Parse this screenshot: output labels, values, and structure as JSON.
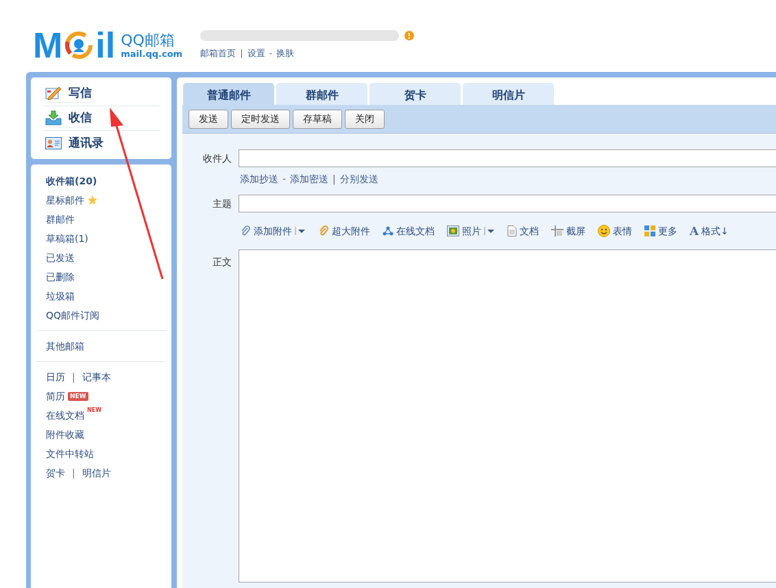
{
  "logo": {
    "left": "M",
    "right": "il",
    "name": "QQ邮箱",
    "domain": "mail.qq.com"
  },
  "top_links": [
    {
      "kind": "link",
      "text": "邮箱首页"
    },
    {
      "kind": "sep",
      "text": "|"
    },
    {
      "kind": "link",
      "text": "设置"
    },
    {
      "kind": "sep",
      "text": "-"
    },
    {
      "kind": "link",
      "text": "换肤"
    }
  ],
  "quick_actions": [
    {
      "kind": "compose",
      "label": "写信"
    },
    {
      "kind": "inbox",
      "label": "收信"
    },
    {
      "kind": "contacts",
      "label": "通讯录"
    }
  ],
  "folders": [
    {
      "kind": "item",
      "label": "收件箱(20)",
      "bold": true
    },
    {
      "kind": "item",
      "label": "星标邮件",
      "star": true
    },
    {
      "kind": "item",
      "label": "群邮件"
    },
    {
      "kind": "item",
      "label": "草稿箱(1)"
    },
    {
      "kind": "item",
      "label": "已发送"
    },
    {
      "kind": "item",
      "label": "已删除"
    },
    {
      "kind": "item",
      "label": "垃圾箱"
    },
    {
      "kind": "item",
      "label": "QQ邮件订阅"
    },
    {
      "kind": "divider"
    },
    {
      "kind": "item",
      "label": "其他邮箱"
    },
    {
      "kind": "divider"
    },
    {
      "kind": "pair",
      "label": "日历",
      "sep": "|",
      "label2": "记事本"
    },
    {
      "kind": "item",
      "label": "简历",
      "badge": {
        "text": "NEW",
        "kind": "box"
      }
    },
    {
      "kind": "item",
      "label": "在线文档",
      "badge": {
        "text": "NEW",
        "kind": "raised"
      }
    },
    {
      "kind": "item",
      "label": "附件收藏"
    },
    {
      "kind": "item",
      "label": "文件中转站"
    },
    {
      "kind": "pair",
      "label": "贺卡",
      "sep": "|",
      "label2": "明信片"
    }
  ],
  "tabs": [
    {
      "label": "普通邮件",
      "selected": true
    },
    {
      "label": "群邮件",
      "selected": false
    },
    {
      "label": "贺卡",
      "selected": false
    },
    {
      "label": "明信片",
      "selected": false
    }
  ],
  "buttons": [
    "发送",
    "定时发送",
    "存草稿",
    "关闭"
  ],
  "compose": {
    "to_label": "收件人",
    "to_links": [
      {
        "kind": "link",
        "text": "添加抄送"
      },
      {
        "kind": "sep",
        "text": "-"
      },
      {
        "kind": "link",
        "text": "添加密送"
      },
      {
        "kind": "sep",
        "text": "|"
      },
      {
        "kind": "link",
        "text": "分别发送"
      }
    ],
    "subject_label": "主题",
    "tools": [
      {
        "kind": "clip",
        "label": "添加附件",
        "dropdown": true
      },
      {
        "kind": "bigclip",
        "label": "超大附件"
      },
      {
        "kind": "share",
        "label": "在线文档"
      },
      {
        "kind": "photo",
        "label": "照片",
        "dropdown": true
      },
      {
        "kind": "doc",
        "label": "文档"
      },
      {
        "kind": "screenshot",
        "label": "截屏"
      },
      {
        "kind": "smiley",
        "label": "表情"
      },
      {
        "kind": "grid",
        "label": "更多"
      },
      {
        "kind": "format",
        "glyph": "A",
        "label": "格式↓"
      }
    ],
    "body_label": "正文"
  }
}
